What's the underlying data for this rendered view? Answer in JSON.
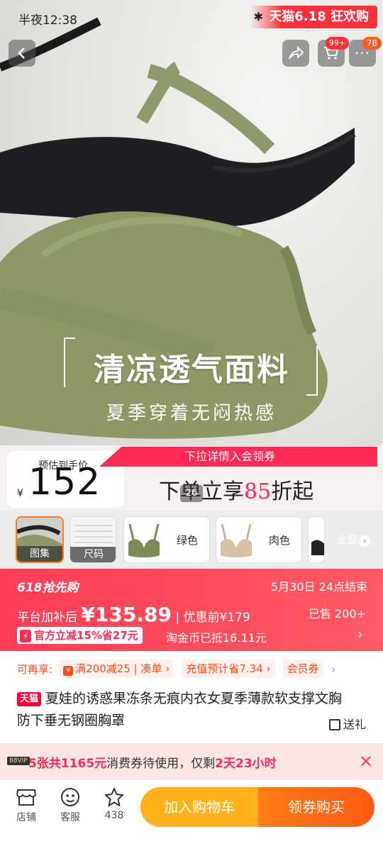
{
  "status_bar": {
    "time": "半夜12:38"
  },
  "header": {
    "tmall_banner": "天猫6.18 狂欢购",
    "cart_badge": "99+",
    "message_badge": "78"
  },
  "hero": {
    "title": "清凉透气面料",
    "subtitle": "夏季穿着无闷热感",
    "page_indicator": "26"
  },
  "price": {
    "label": "预估到手价",
    "currency": "¥",
    "value": "152",
    "coupon_banner": "下拉详情入会领券",
    "discount_prefix": "下单立享",
    "discount_num": "85",
    "discount_suffix": "折起"
  },
  "thumbnails": [
    {
      "caption": "图集"
    },
    {
      "caption": "尺码"
    },
    {
      "label": "绿色"
    },
    {
      "label": "肉色"
    }
  ],
  "thumbnails_all": "全部",
  "promo": {
    "event": "618抢先购",
    "end_time": "5月30日 24点结束",
    "subsidy_label": "平台加补后",
    "subsidy_price": "¥135.89",
    "divider": "|",
    "before_label": "优惠前¥179",
    "sold": "已售 200+",
    "gov_tag": "官方立减15%省27元",
    "taojin": "淘金币已抵16.11元"
  },
  "info": {
    "enjoy_label": "可再享:",
    "chips": [
      "满200减25 | 凑单",
      "充值预计省7.34",
      "会员券"
    ],
    "tmall_tag": "天猫",
    "title": "夏娃的诱惑果冻条无痕内衣女夏季薄款软支撑文胸防下垂无钢圈胸罩",
    "gift": "送礼"
  },
  "vip_bar": {
    "tag": "88VIP",
    "count_text": "5张共1165元",
    "middle": "消费券待使用，仅剩",
    "remaining": "2天23小时"
  },
  "bottom_bar": {
    "shop": "店铺",
    "service": "客服",
    "favorites": "438",
    "add_to_cart": "加入购物车",
    "buy": "领券购买"
  }
}
